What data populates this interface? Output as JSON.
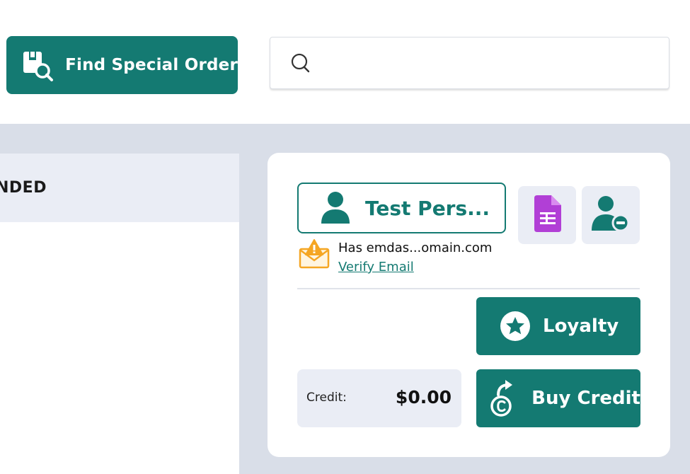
{
  "topbar": {
    "find_special_order_label": "Find Special Order",
    "search": {
      "value": "",
      "placeholder": ""
    }
  },
  "left_panel": {
    "header_text": "NDED"
  },
  "customer": {
    "name": "Test Pers...",
    "email_notice": "Has emdas...omain.com",
    "verify_email_label": "Verify Email",
    "loyalty_label": "Loyalty",
    "credit_label": "Credit:",
    "credit_value": "$0.00",
    "buy_credit_label": "Buy Credit"
  },
  "icons": {
    "find_special_order": "package-search-icon",
    "search": "search-icon",
    "customer": "person-icon",
    "document": "document-spreadsheet-icon",
    "remove_customer": "user-remove-icon",
    "email_warning": "email-warning-icon",
    "loyalty": "star-circle-icon",
    "buy_credit": "coin-arrow-icon"
  },
  "colors": {
    "accent": "#147a72",
    "panel_background": "#d9dee8",
    "light_fill": "#eaedf5",
    "document_icon": "#b13fd6",
    "warning": "#f5a623"
  }
}
